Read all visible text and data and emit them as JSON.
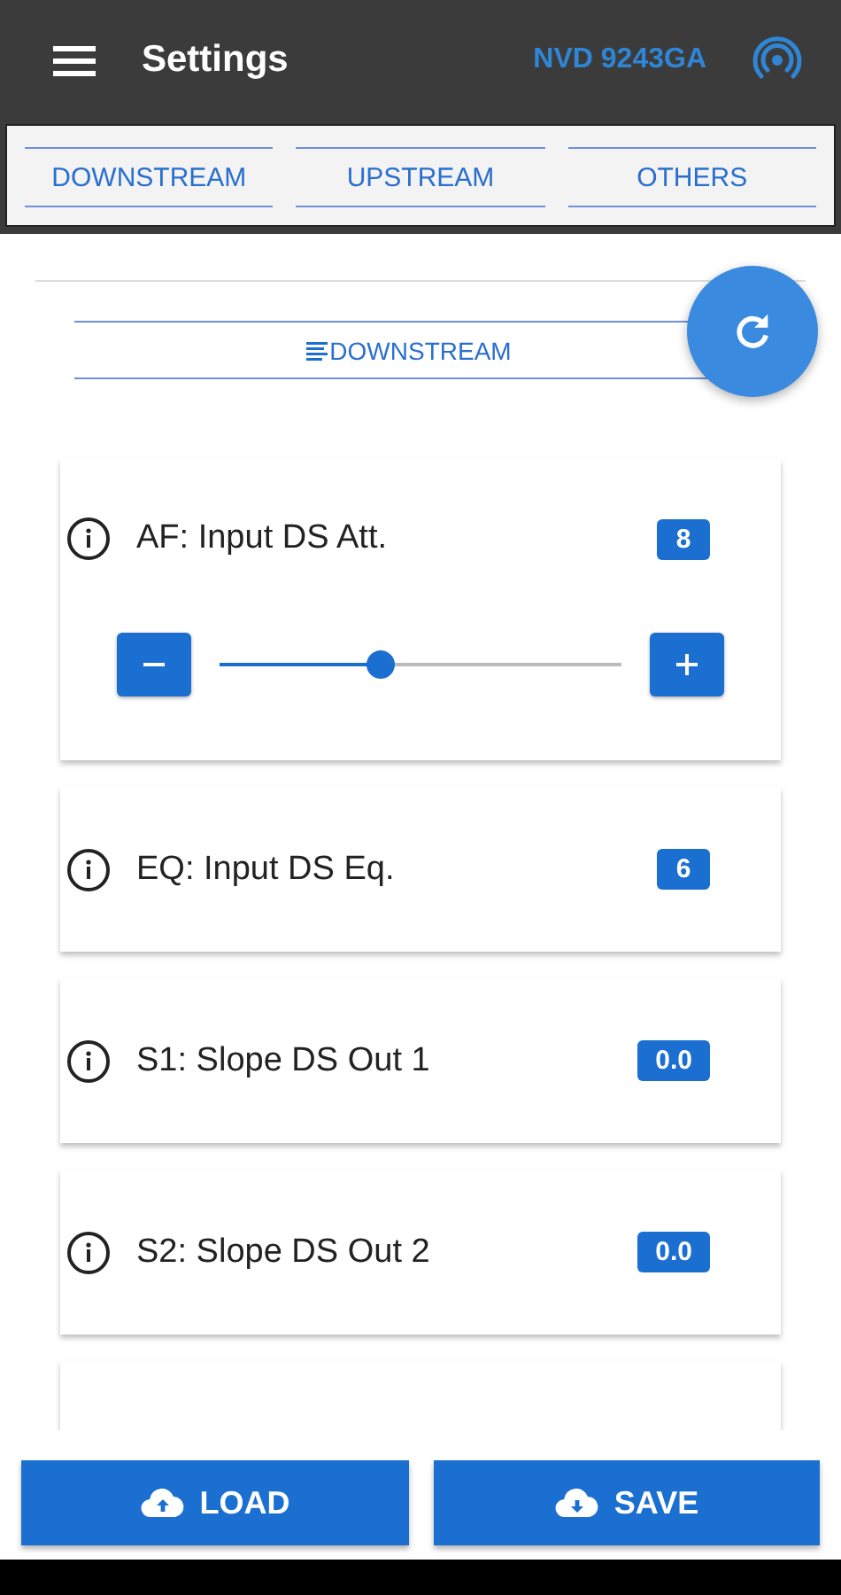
{
  "app_bar": {
    "title": "Settings",
    "device": "NVD 9243GA"
  },
  "tabs": [
    {
      "label": "DOWNSTREAM"
    },
    {
      "label": "UPSTREAM"
    },
    {
      "label": "OTHERS"
    }
  ],
  "section": {
    "title": "DOWNSTREAM"
  },
  "settings": [
    {
      "kind": "slider",
      "label": "AF: Input DS Att.",
      "value": "8",
      "level": 0.4
    },
    {
      "kind": "value",
      "label": "EQ: Input DS Eq.",
      "value": "6"
    },
    {
      "kind": "value",
      "label": "S1: Slope DS Out 1",
      "value": "0.0"
    },
    {
      "kind": "value",
      "label": "S2: Slope DS Out 2",
      "value": "0.0"
    }
  ],
  "buttons": [
    {
      "label": "LOAD",
      "kind": "upload"
    },
    {
      "label": "SAVE",
      "kind": "download"
    }
  ]
}
